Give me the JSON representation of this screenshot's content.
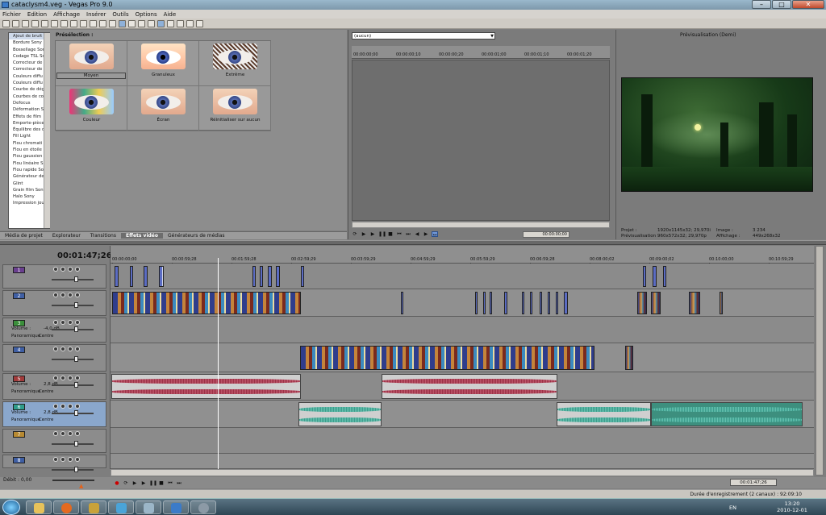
{
  "window": {
    "title": "cataclysm4.veg - Vegas Pro 9.0",
    "controls": [
      "–",
      "□",
      "✕"
    ]
  },
  "menu": [
    "Fichier",
    "Edition",
    "Affichage",
    "Insérer",
    "Outils",
    "Options",
    "Aide"
  ],
  "effects_list": {
    "items": [
      "Ajout de bruit",
      "Bordure Sony",
      "Bossellage Son",
      "Codage TSL Sc",
      "Correcteur de",
      "Correcteur de",
      "Couleurs diffu",
      "Couleurs diffu",
      "Courbe de dég",
      "Courbes de co",
      "Defocus",
      "Déformation S",
      "Effets de film",
      "Emporte-pièce",
      "Équilibre des c",
      "Fill Light",
      "Flou chromati",
      "Flou en étoile",
      "Flou gaussien",
      "Flou linéaire S",
      "Flou rapide So",
      "Générateur de",
      "Glint",
      "Grain film Sony",
      "Halo Sony",
      "Impression jou"
    ],
    "selected_index": 0
  },
  "presets": {
    "label": "Présélection :",
    "items": [
      {
        "label": "Moyen",
        "style": "normal"
      },
      {
        "label": "Granuleux",
        "style": "grain"
      },
      {
        "label": "Extrême",
        "style": "ext"
      },
      {
        "label": "Couleur",
        "style": "col"
      },
      {
        "label": "Écran",
        "style": "normal"
      },
      {
        "label": "Réinitialiser sur aucun",
        "style": "normal"
      }
    ],
    "selected_index": 0
  },
  "bottom_tabs": [
    "Média de projet",
    "Explorateur",
    "Transitions",
    "Effets vidéo",
    "Générateurs de médias"
  ],
  "active_tab": "Effets vidéo",
  "trimmer": {
    "select_value": "(aucun)",
    "ruler": [
      "00:00:00;00",
      "00:00:00;10",
      "00:00:00;20",
      "00:00:01;00",
      "00:00:01;10",
      "00:00:01;20"
    ],
    "time": "00:00:00;00"
  },
  "preview": {
    "mode_label": "Prévisualisation (Demi)",
    "info": {
      "projet_label": "Projet :",
      "projet_value": "1920x1145x32; 29,970i",
      "prev_label": "Prévisualisation :",
      "prev_value": "960x572x32; 29,970p",
      "image_label": "Image :",
      "image_value": "3 234",
      "affichage_label": "Affichage :",
      "affichage_value": "449x268x32"
    }
  },
  "timeline": {
    "current_time": "00:01:47;26",
    "ruler": [
      "00:00:00;00",
      "00:00:59;28",
      "00:01:59;28",
      "00:02:59;29",
      "00:03:59;29",
      "00:04:59;29",
      "00:05:59;29",
      "00:06:59;28",
      "00:08:00;02",
      "00:09:00;02",
      "00:10:00;00",
      "00:10:59;29"
    ],
    "tracks": [
      {
        "num": "1",
        "type": "video",
        "color": "#6a3f8f"
      },
      {
        "num": "2",
        "type": "video",
        "color": "#3f5fa4"
      },
      {
        "num": "3",
        "type": "audio",
        "color": "#3b8f3b",
        "volume_label": "Volume :",
        "volume": "-4,0 dB",
        "pan_label": "Panoramique :",
        "pan": "Centre"
      },
      {
        "num": "4",
        "type": "video",
        "color": "#3f5fa4"
      },
      {
        "num": "5",
        "type": "audio",
        "color": "#a13a3a",
        "volume_label": "Volume :",
        "volume": "2,8 dB",
        "pan_label": "Panoramique :",
        "pan": "Centre"
      },
      {
        "num": "6",
        "type": "audio",
        "color": "#2e9c8b",
        "volume_label": "Volume :",
        "volume": "2,8 dB",
        "pan_label": "Panoramique :",
        "pan": "Centre"
      },
      {
        "num": "7",
        "type": "video",
        "color": "#b88a32"
      },
      {
        "num": "8",
        "type": "video",
        "color": "#3f5fa4"
      }
    ],
    "end_time": "00:01:47;26",
    "rate_label": "Débit : 0,00",
    "record_status": "Durée d'enregistrement (2 canaux) : 92:09:10"
  },
  "taskbar": {
    "lang": "EN",
    "time": "13:20",
    "date": "2010-12-01"
  }
}
